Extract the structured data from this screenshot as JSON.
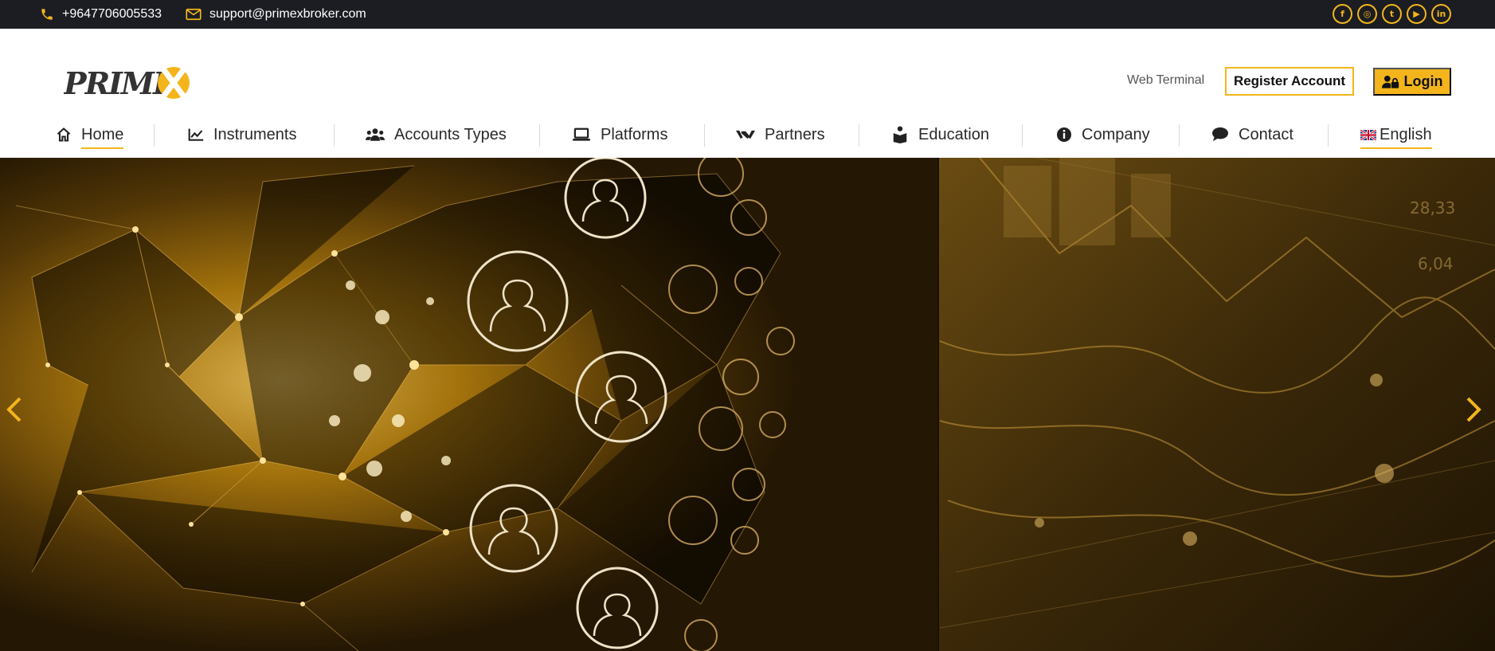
{
  "topbar": {
    "phone": "+9647706005533",
    "email": "support@primexbroker.com",
    "socials": [
      {
        "name": "facebook-icon",
        "glyph": "f"
      },
      {
        "name": "instagram-icon",
        "glyph": "◎"
      },
      {
        "name": "twitter-icon",
        "glyph": "t"
      },
      {
        "name": "youtube-icon",
        "glyph": "▶"
      },
      {
        "name": "linkedin-icon",
        "glyph": "in"
      }
    ]
  },
  "header": {
    "logo_text": "PRIMEX",
    "web_terminal": "Web Terminal",
    "register": "Register Account",
    "login": "Login"
  },
  "nav": {
    "items": [
      {
        "label": "Home",
        "icon": "home-icon",
        "active": true
      },
      {
        "label": "Instruments",
        "icon": "chart-line-icon"
      },
      {
        "label": "Accounts Types",
        "icon": "users-icon"
      },
      {
        "label": "Platforms",
        "icon": "laptop-icon"
      },
      {
        "label": "Partners",
        "icon": "handshake-icon"
      },
      {
        "label": "Education",
        "icon": "book-reader-icon"
      },
      {
        "label": "Company",
        "icon": "info-circle-icon"
      },
      {
        "label": "Contact",
        "icon": "comment-icon"
      },
      {
        "label": "English",
        "icon": "uk-flag-icon",
        "active": true
      }
    ]
  },
  "colors": {
    "accent": "#f3b51b",
    "topbar_bg": "#1b1d22",
    "hero_gold": "#b07d12",
    "hero_dark": "#2a1c05"
  }
}
